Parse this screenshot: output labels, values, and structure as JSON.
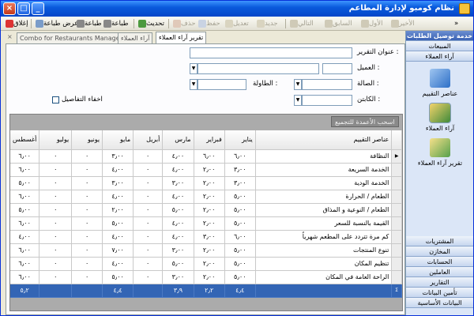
{
  "window": {
    "title": "نظام كومبو لإدارة المطاعم"
  },
  "toolbar": {
    "close_label": "إغلاق",
    "print_preview_label": "عرض طباعة",
    "print_label": "طباعة",
    "print2_label": "طباعة",
    "refresh_label": "تحديث",
    "disabled_items": [
      "حذف",
      "حفظ",
      "تعديل",
      "جديد",
      "التالي",
      "السابق",
      "الأول",
      "الأخير"
    ]
  },
  "tabs": [
    {
      "label": "تقرير آراء العملاء",
      "active": true
    },
    {
      "label": "آراء العملاء",
      "active": false
    },
    {
      "label": "Combo for Restaurants Management",
      "active": false
    }
  ],
  "form": {
    "report_title_label": "عنوان التقرير :",
    "customer_label": "العميل :",
    "hall_label": "الصالة :",
    "table_label": "الطاولة :",
    "captain_label": "الكابتن :",
    "hide_details_label": "اخفاء التفاصيل",
    "group_by_hint": "اسحب الأعمدة للتجميع"
  },
  "grid": {
    "columns": [
      "عناصر التقييم",
      "يناير",
      "فبراير",
      "مارس",
      "أبريل",
      "مايو",
      "يونيو",
      "يوليو",
      "أغسطس"
    ],
    "rows": [
      [
        "النظافة",
        "٦٫٠٠",
        "٦٫٠٠",
        "٤٫٠٠",
        "٠",
        "٣٫٠٠",
        "٠",
        "٠",
        "٦٫٠٠"
      ],
      [
        "الخدمة السريعة",
        "٣٫٠٠",
        "٢٫٠٠",
        "٤٫٠٠",
        "٠",
        "٤٫٠٠",
        "٠",
        "٠",
        "٦٫٠٠"
      ],
      [
        "الخدمة الودية",
        "٣٫٠٠",
        "٢٫٠٠",
        "٣٫٠٠",
        "٠",
        "٣٫٠٠",
        "٠",
        "٠",
        "٥٫٠٠"
      ],
      [
        "الطعام / الحرارة",
        "٥٫٠٠",
        "٢٫٠٠",
        "٤٫٠٠",
        "٠",
        "٤٫٠٠",
        "٠",
        "٠",
        "٦٫٠٠"
      ],
      [
        "الطعام / النوعية و المذاق",
        "٥٫٠٠",
        "٢٫٠٠",
        "٥٫٠٠",
        "٠",
        "٢٫٠٠",
        "٠",
        "٠",
        "٥٫٠٠"
      ],
      [
        "القيمة بالنسبة للسعر",
        "٥٫٠٠",
        "٢٫٠٠",
        "٤٫٠٠",
        "٠",
        "٥٫٠٠",
        "٠",
        "٠",
        "٦٫٠٠"
      ],
      [
        "كم مرة تتردد على المطعم شهرياً",
        "٦٫٠٠",
        "٣٫٠٠",
        "٤٫٠٠",
        "٠",
        "٤٫٠٠",
        "٠",
        "٠",
        "٤٫٠٠"
      ],
      [
        "تنوع المنتجات",
        "٥٫٠٠",
        "٢٫٠٠",
        "٣٫٠٠",
        "٠",
        "٧٫٠٠",
        "٠",
        "٠",
        "٦٫٠٠"
      ],
      [
        "تنظيم المكان",
        "٥٫٠٠",
        "٢٫٠٠",
        "٥٫٠٠",
        "٠",
        "٤٫٠٠",
        "٠",
        "٠",
        "٦٫٠٠"
      ],
      [
        "الراحة العامة في المكان",
        "٥٫٠٠",
        "٢٫٠٠",
        "٣٫٠٠",
        "٠",
        "٥٫٠٠",
        "٠",
        "٠",
        "٦٫٠٠"
      ]
    ],
    "total_row": [
      "",
      "٤٫٤",
      "٢٫٢",
      "٣٫٩",
      "",
      "٤٫٤",
      "",
      "",
      "٥٫٢"
    ],
    "total_symbol": "Σ"
  },
  "sidebar": {
    "top_header": "خدمة توصيل الطلبات",
    "header_sales": "المبيعات",
    "header_customer_opinions": "آراء العملاء",
    "items": [
      {
        "label": "عناصر التقييم",
        "icon": "survey-items-icon"
      },
      {
        "label": "آراء العملاء",
        "icon": "customer-opinions-icon"
      },
      {
        "label": "تقرير آراء العملاء",
        "icon": "opinions-report-icon"
      }
    ],
    "bottom_headers": [
      "المشتريات",
      "المخازن",
      "الحسابات",
      "العاملين",
      "التقارير",
      "تأمين البيانات",
      "البيانات الأساسية"
    ]
  }
}
